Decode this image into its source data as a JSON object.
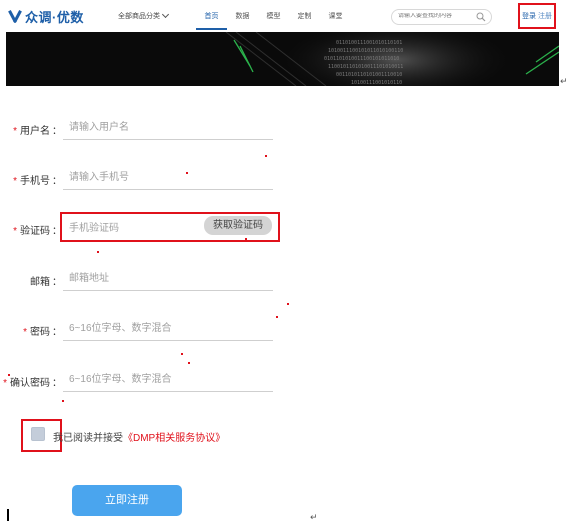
{
  "header": {
    "logo_text": "众调·优数",
    "category_label": "全部商品分类",
    "nav": [
      "首页",
      "数据",
      "模型",
      "定制",
      "课堂"
    ],
    "active_nav_index": 0,
    "search_placeholder": "请输入要查找的内容",
    "login_label": "登录",
    "register_label": "注册"
  },
  "form": {
    "fields": [
      {
        "label": "用户名",
        "required": true,
        "placeholder": "请输入用户名"
      },
      {
        "label": "手机号",
        "required": true,
        "placeholder": "请输入手机号"
      },
      {
        "label": "验证码",
        "required": true,
        "placeholder": "手机验证码"
      },
      {
        "label": "邮箱",
        "required": false,
        "placeholder": "邮箱地址"
      },
      {
        "label": "密码",
        "required": true,
        "placeholder": "6~16位字母、数字混合"
      },
      {
        "label": "确认密码",
        "required": true,
        "placeholder": "6~16位字母、数字混合"
      }
    ],
    "get_code_label": "获取验证码",
    "agree_text": "我已阅读并接受",
    "agree_link": "《DMP相关服务协议》",
    "submit_label": "立即注册"
  },
  "colors": {
    "brand": "#1e5fa8",
    "required_star": "#e0111b",
    "annotation_box": "#e0111b",
    "submit": "#4aa5ee",
    "banner": "#0a0a0a"
  },
  "icons": [
    "logo-icon",
    "chevron-down-icon",
    "search-icon",
    "checkbox-icon",
    "return-mark-icon"
  ]
}
